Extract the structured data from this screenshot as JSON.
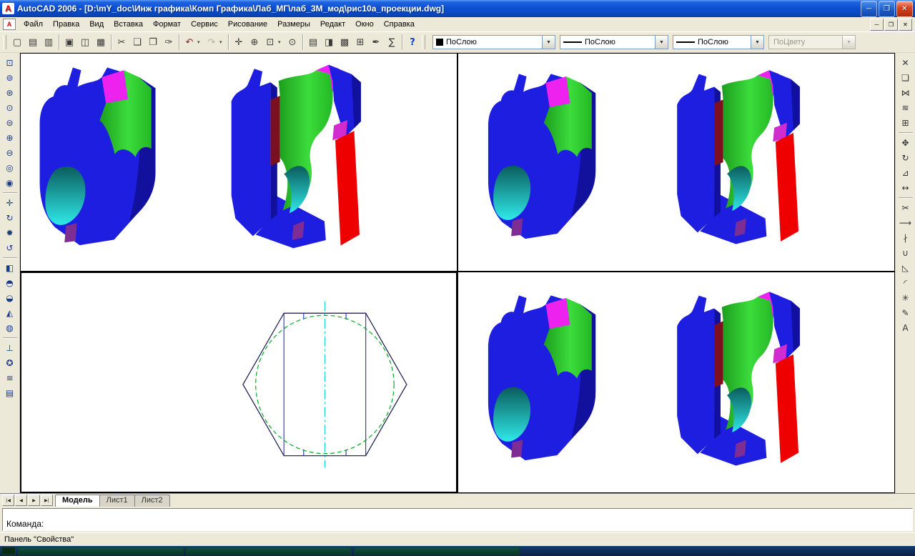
{
  "window": {
    "title": "AutoCAD 2006 - [D:\\mY_doc\\Инж графика\\Комп Графика\\Лаб_МГ\\лаб_3М_мод\\рис10а_проекции.dwg]",
    "icon_glyph": "A",
    "controls": {
      "minimize": "─",
      "restore": "❐",
      "close": "✕"
    }
  },
  "menubar": {
    "items": [
      {
        "id": "file",
        "label": "Файл"
      },
      {
        "id": "edit",
        "label": "Правка"
      },
      {
        "id": "view",
        "label": "Вид"
      },
      {
        "id": "insert",
        "label": "Вставка"
      },
      {
        "id": "format",
        "label": "Формат"
      },
      {
        "id": "tools",
        "label": "Сервис"
      },
      {
        "id": "draw",
        "label": "Рисование"
      },
      {
        "id": "dimension",
        "label": "Размеры"
      },
      {
        "id": "modify",
        "label": "Редакт"
      },
      {
        "id": "window",
        "label": "Окно"
      },
      {
        "id": "help",
        "label": "Справка"
      }
    ],
    "doc_controls": {
      "minimize": "─",
      "restore": "❐",
      "close": "✕"
    }
  },
  "toolbar": {
    "standard": [
      {
        "name": "new-file",
        "glyph": "▢"
      },
      {
        "name": "open-file",
        "glyph": "▤"
      },
      {
        "name": "save",
        "glyph": "▥"
      },
      {
        "sep": true
      },
      {
        "name": "plot",
        "glyph": "▣"
      },
      {
        "name": "plot-preview",
        "glyph": "◫"
      },
      {
        "name": "publish",
        "glyph": "▦"
      },
      {
        "sep": true
      },
      {
        "name": "cut",
        "glyph": "✂"
      },
      {
        "name": "copy",
        "glyph": "❏"
      },
      {
        "name": "paste",
        "glyph": "❐"
      },
      {
        "name": "match-properties",
        "glyph": "✑"
      },
      {
        "sep": true
      },
      {
        "name": "undo",
        "glyph": "↶",
        "color": "c-maroon",
        "arrow": true
      },
      {
        "name": "redo",
        "glyph": "↷",
        "disabled": true,
        "arrow": true
      },
      {
        "sep": true
      },
      {
        "name": "pan-realtime",
        "glyph": "✛"
      },
      {
        "name": "zoom-realtime",
        "glyph": "⊕"
      },
      {
        "name": "zoom-window",
        "glyph": "⊡",
        "arrow": true
      },
      {
        "name": "zoom-previous",
        "glyph": "⊙"
      },
      {
        "sep": true
      },
      {
        "name": "properties",
        "glyph": "▤"
      },
      {
        "name": "designcenter",
        "glyph": "◨"
      },
      {
        "name": "tool-palettes",
        "glyph": "▩"
      },
      {
        "name": "sheet-set-manager",
        "glyph": "⊞"
      },
      {
        "name": "markup-set-manager",
        "glyph": "✒"
      },
      {
        "name": "quickcalc",
        "glyph": "∑"
      },
      {
        "sep": true
      },
      {
        "name": "help",
        "glyph": "?",
        "color": "c-blue"
      }
    ],
    "properties": {
      "color_value": "ПоСлою",
      "linetype_value": "ПоСлою",
      "lineweight_value": "ПоСлою",
      "plotstyle_value": "ПоЦвету",
      "dropdown_glyph": "▼"
    }
  },
  "left_toolbar": {
    "buttons": [
      {
        "name": "zoom-window",
        "glyph": "⊡"
      },
      {
        "name": "zoom-dynamic",
        "glyph": "⊚"
      },
      {
        "name": "zoom-scale",
        "glyph": "⊛"
      },
      {
        "name": "zoom-center",
        "glyph": "⊙"
      },
      {
        "name": "zoom-object",
        "glyph": "⊜"
      },
      {
        "name": "zoom-in",
        "glyph": "⊕"
      },
      {
        "name": "zoom-out",
        "glyph": "⊖"
      },
      {
        "name": "zoom-all",
        "glyph": "◎"
      },
      {
        "name": "zoom-extents",
        "glyph": "◉"
      },
      {
        "sep": true
      },
      {
        "name": "pan",
        "glyph": "✛"
      },
      {
        "name": "orbit",
        "glyph": "↻"
      },
      {
        "name": "redraw",
        "glyph": "✹"
      },
      {
        "name": "regen",
        "glyph": "↺"
      },
      {
        "sep": true
      },
      {
        "name": "named-views",
        "glyph": "◧"
      },
      {
        "name": "top-view",
        "glyph": "◓"
      },
      {
        "name": "front-view",
        "glyph": "◒"
      },
      {
        "name": "iso-view",
        "glyph": "◭"
      },
      {
        "name": "hide",
        "glyph": "◍"
      },
      {
        "sep": true
      },
      {
        "name": "ucs",
        "glyph": "⊥"
      },
      {
        "name": "ucs-world",
        "glyph": "✪"
      },
      {
        "name": "draw-order",
        "glyph": "≡"
      },
      {
        "name": "layer-properties",
        "glyph": "▤"
      }
    ]
  },
  "right_toolbar": {
    "buttons": [
      {
        "name": "erase",
        "glyph": "✕"
      },
      {
        "name": "copy-object",
        "glyph": "❏"
      },
      {
        "name": "mirror",
        "glyph": "⋈"
      },
      {
        "name": "offset",
        "glyph": "≋"
      },
      {
        "name": "array",
        "glyph": "⊞"
      },
      {
        "sep": true
      },
      {
        "name": "move",
        "glyph": "✥"
      },
      {
        "name": "rotate",
        "glyph": "↻"
      },
      {
        "name": "scale",
        "glyph": "⊿"
      },
      {
        "name": "stretch",
        "glyph": "↔"
      },
      {
        "sep": true
      },
      {
        "name": "trim",
        "glyph": "✂"
      },
      {
        "name": "extend",
        "glyph": "⟶"
      },
      {
        "name": "break",
        "glyph": "∤"
      },
      {
        "name": "join",
        "glyph": "∪"
      },
      {
        "name": "chamfer",
        "glyph": "◺"
      },
      {
        "name": "fillet",
        "glyph": "◜"
      },
      {
        "name": "explode",
        "glyph": "✳",
        "color": "c-maroon"
      },
      {
        "name": "edit-polyline",
        "glyph": "✎",
        "color": "c-red"
      },
      {
        "name": "multiline-text",
        "glyph": "А",
        "color": "c-red"
      }
    ]
  },
  "tabbar": {
    "nav": [
      {
        "id": "first-tab",
        "glyph": "|◀"
      },
      {
        "id": "prev-tab",
        "glyph": "◀"
      },
      {
        "id": "next-tab",
        "glyph": "▶"
      },
      {
        "id": "last-tab",
        "glyph": "▶|"
      }
    ],
    "tabs": [
      {
        "id": "model",
        "label": "Модель",
        "active": true
      },
      {
        "id": "layout1",
        "label": "Лист1",
        "active": false
      },
      {
        "id": "layout2",
        "label": "Лист2",
        "active": false
      }
    ]
  },
  "command": {
    "prompt": "Команда:"
  },
  "statusbar": {
    "message": "Панель \"Свойства\""
  },
  "colors": {
    "solid_blue": "#1e1ee0",
    "solid_dark_blue": "#11119e",
    "solid_green": "#2ecc2e",
    "solid_magenta": "#ee22ee",
    "solid_cyan": "#2fe9e9",
    "solid_red": "#ee0000",
    "solid_dark_red": "#7c1022",
    "solid_purple": "#7d2d93"
  }
}
